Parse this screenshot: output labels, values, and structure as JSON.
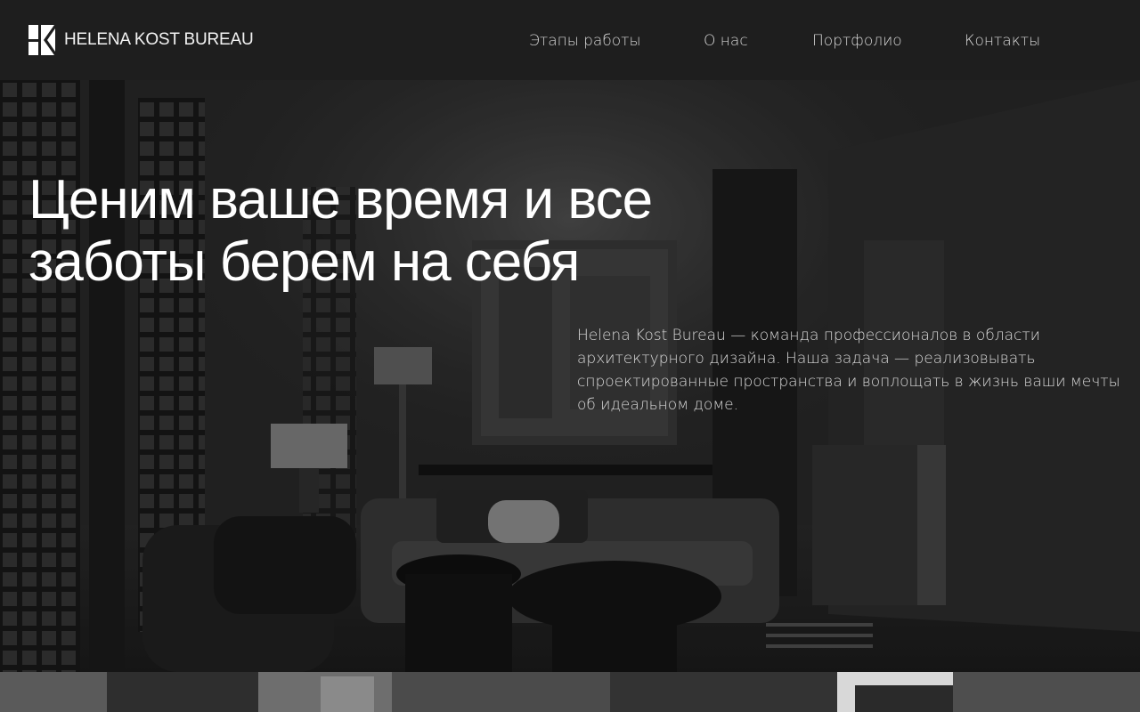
{
  "brand": {
    "name": "HELENA KOST BUREAU",
    "logo_icon": "hk-monogram-icon"
  },
  "nav": {
    "items": [
      {
        "label": "Этапы работы"
      },
      {
        "label": "О нас"
      },
      {
        "label": "Портфолио"
      },
      {
        "label": "Контакты"
      }
    ]
  },
  "hero": {
    "title": "Ценим ваше время и все заботы берем на себя",
    "description": "Helena Kost Bureau — команда профессионалов в области архитектурного дизайна. Наша задача — реализовывать спроектированные пространства и воплощать в жизнь ваши мечты об идеальном доме."
  },
  "colors": {
    "header_bg": "#1e1e1e",
    "text_primary": "#ffffff",
    "text_nav": "#d6d6d6"
  }
}
